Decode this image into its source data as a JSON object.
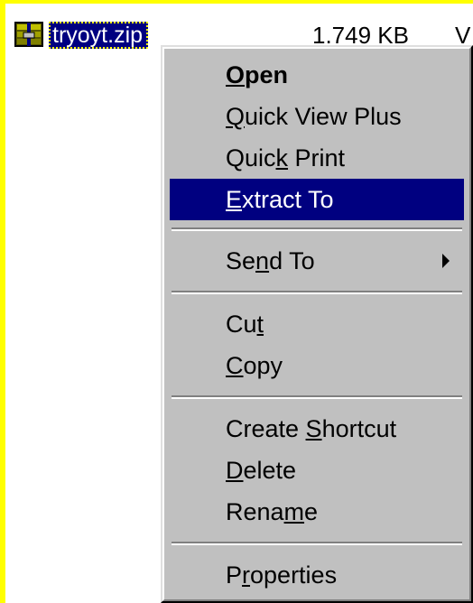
{
  "file": {
    "name": "tryoyt.zip",
    "size": "1.749 KB",
    "type_fragment": "V",
    "icon": "zip-archive-icon"
  },
  "menu": {
    "items": [
      {
        "label": "Open",
        "mnemonic": "O"
      },
      {
        "label": "Quick View Plus",
        "mnemonic": "Q"
      },
      {
        "label": "Quick Print",
        "mnemonic": "k"
      },
      {
        "label": "Extract To",
        "mnemonic": "E",
        "highlighted": true
      },
      {
        "label": "Send To",
        "mnemonic": "n",
        "submenu": true
      },
      {
        "label": "Cut",
        "mnemonic": "t"
      },
      {
        "label": "Copy",
        "mnemonic": "C"
      },
      {
        "label": "Create Shortcut",
        "mnemonic": "S"
      },
      {
        "label": "Delete",
        "mnemonic": "D"
      },
      {
        "label": "Rename",
        "mnemonic": "m"
      },
      {
        "label": "Properties",
        "mnemonic": "r"
      }
    ]
  },
  "colors": {
    "desktop": "#FFFF00",
    "pane": "#FFFFFF",
    "menu": "#C0C0C0",
    "highlight": "#000080",
    "highlight_text": "#FFFFFF"
  }
}
